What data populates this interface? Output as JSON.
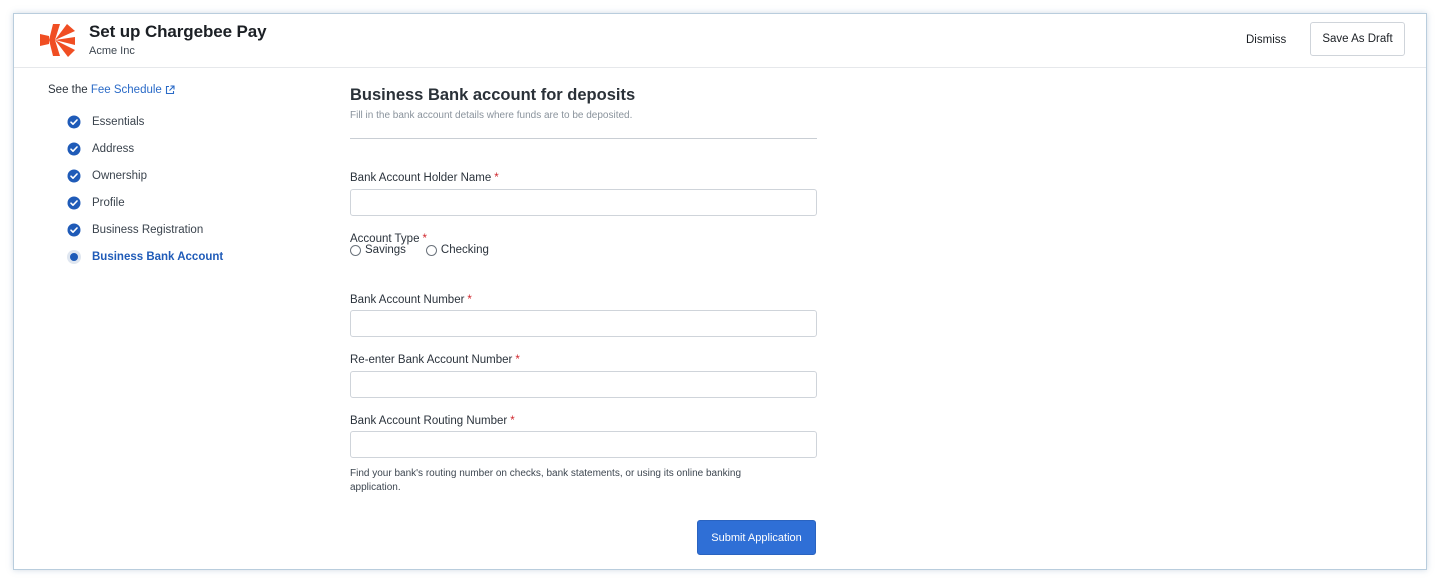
{
  "header": {
    "title": "Set up Chargebee Pay",
    "subtitle": "Acme Inc",
    "dismiss_label": "Dismiss",
    "save_draft_label": "Save As Draft"
  },
  "sidebar": {
    "fee_prefix": "See the",
    "fee_link": "Fee Schedule",
    "steps": [
      {
        "label": "Essentials",
        "status": "complete"
      },
      {
        "label": "Address",
        "status": "complete"
      },
      {
        "label": "Ownership",
        "status": "complete"
      },
      {
        "label": "Profile",
        "status": "complete"
      },
      {
        "label": "Business Registration",
        "status": "complete"
      },
      {
        "label": "Business Bank Account",
        "status": "current"
      }
    ]
  },
  "form": {
    "title": "Business Bank account for deposits",
    "subtitle": "Fill in the bank account details where funds are to be deposited.",
    "required_marker": "*",
    "holder_name": {
      "label": "Bank Account Holder Name",
      "value": ""
    },
    "account_type": {
      "label": "Account Type",
      "options": [
        "Savings",
        "Checking"
      ],
      "selected": null
    },
    "account_number": {
      "label": "Bank Account Number",
      "value": ""
    },
    "reenter_number": {
      "label": "Re-enter Bank Account Number",
      "value": ""
    },
    "routing_number": {
      "label": "Bank Account Routing Number",
      "value": ""
    },
    "routing_help": "Find your bank's routing number on checks, bank statements, or using its online banking application.",
    "submit_label": "Submit Application"
  },
  "colors": {
    "accent": "#2f6fd6",
    "brand": "#f04e23",
    "required": "#d0282e",
    "link": "#2a6ac7"
  }
}
